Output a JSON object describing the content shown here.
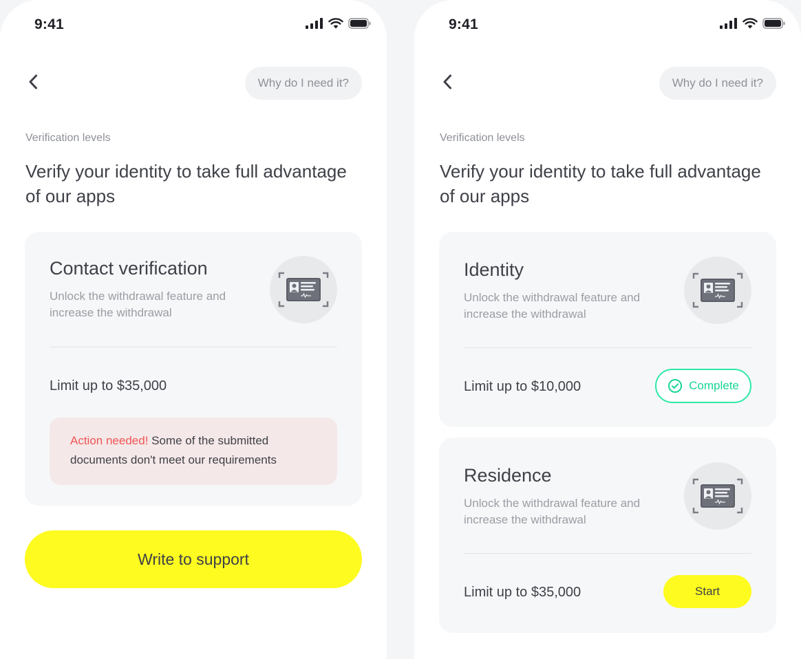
{
  "colors": {
    "accent_yellow": "#fdfb1f",
    "complete_green": "#19d496",
    "action_red": "#f05555",
    "action_bg": "#f5e8e8"
  },
  "left": {
    "status": {
      "time": "9:41"
    },
    "nav": {
      "back_icon": "chevron-left-icon",
      "help_label": "Why do I need it?"
    },
    "subtitle": "Verification levels",
    "heading": "Verify your identity to take full advantage of our apps",
    "card": {
      "title": "Contact verification",
      "description": "Unlock the withdrawal feature and increase the withdrawal",
      "icon": "id-card-icon",
      "limit": "Limit up to $35,000",
      "action_label": "Action needed!",
      "action_message": "Some of the submitted documents don't meet our requirements"
    },
    "support_button": "Write to support"
  },
  "right": {
    "status": {
      "time": "9:41"
    },
    "nav": {
      "back_icon": "chevron-left-icon",
      "help_label": "Why do I need it?"
    },
    "subtitle": "Verification levels",
    "heading": "Verify your identity to take full advantage of our apps",
    "cards": [
      {
        "title": "Identity",
        "description": "Unlock the withdrawal feature and increase the withdrawal",
        "icon": "id-card-icon",
        "limit": "Limit up to $10,000",
        "status_label": "Complete",
        "status_icon": "check-circle-icon"
      },
      {
        "title": "Residence",
        "description": "Unlock the withdrawal feature and increase the withdrawal",
        "icon": "id-card-icon",
        "limit": "Limit up to $35,000",
        "button_label": "Start"
      }
    ]
  }
}
